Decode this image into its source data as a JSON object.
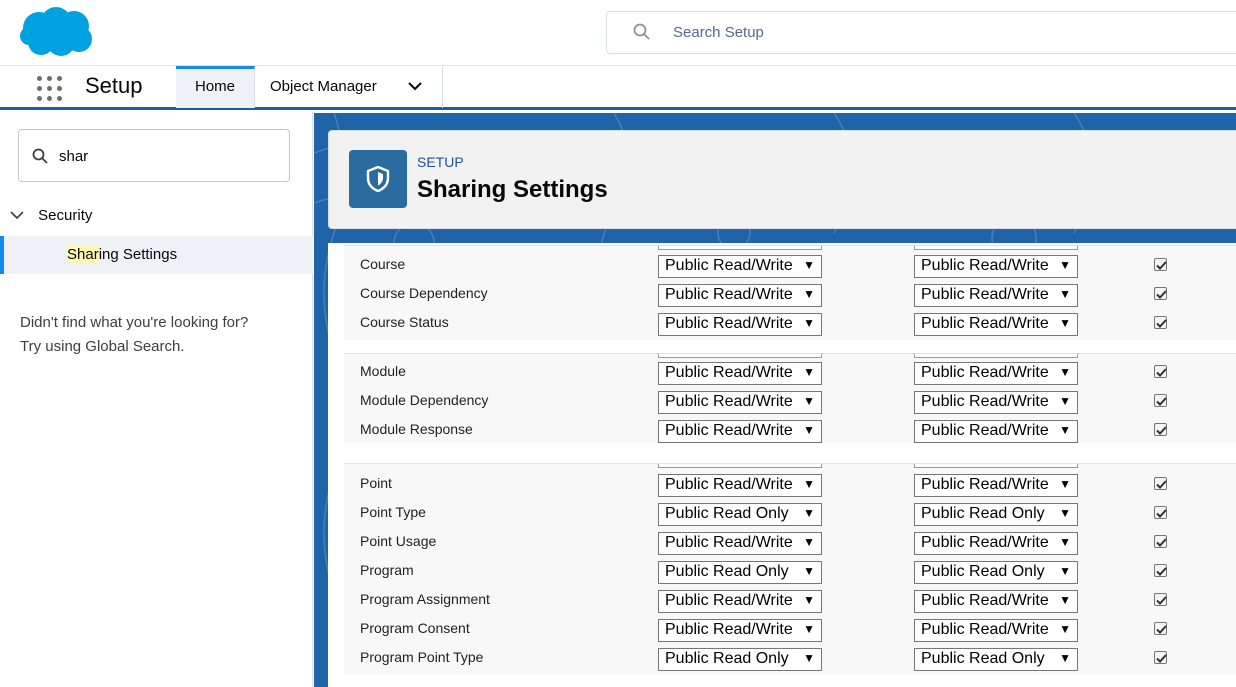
{
  "header": {
    "search_placeholder": "Search Setup"
  },
  "nav": {
    "app_name": "Setup",
    "tabs": [
      {
        "label": "Home"
      },
      {
        "label": "Object Manager"
      }
    ]
  },
  "sidebar": {
    "search_value": "shar",
    "section": "Security",
    "item_highlight": "Shar",
    "item_rest": "ing Settings",
    "help_line1": "Didn't find what you're looking for?",
    "help_line2": "Try using Global Search."
  },
  "page": {
    "breadcrumb": "SETUP",
    "title": "Sharing Settings"
  },
  "groups": [
    {
      "rows": [
        {
          "name": "Course",
          "access_a": "Public Read/Write",
          "access_b": "Public Read/Write",
          "checked": true
        },
        {
          "name": "Course Dependency",
          "access_a": "Public Read/Write",
          "access_b": "Public Read/Write",
          "checked": true
        },
        {
          "name": "Course Status",
          "access_a": "Public Read/Write",
          "access_b": "Public Read/Write",
          "checked": true
        }
      ]
    },
    {
      "rows": [
        {
          "name": "Module",
          "access_a": "Public Read/Write",
          "access_b": "Public Read/Write",
          "checked": true
        },
        {
          "name": "Module Dependency",
          "access_a": "Public Read/Write",
          "access_b": "Public Read/Write",
          "checked": true
        },
        {
          "name": "Module Response",
          "access_a": "Public Read/Write",
          "access_b": "Public Read/Write",
          "checked": true
        }
      ]
    },
    {
      "rows": [
        {
          "name": "Point",
          "access_a": "Public Read/Write",
          "access_b": "Public Read/Write",
          "checked": true
        },
        {
          "name": "Point Type",
          "access_a": "Public Read Only",
          "access_b": "Public Read Only",
          "checked": true
        },
        {
          "name": "Point Usage",
          "access_a": "Public Read/Write",
          "access_b": "Public Read/Write",
          "checked": true
        },
        {
          "name": "Program",
          "access_a": "Public Read Only",
          "access_b": "Public Read Only",
          "checked": true
        },
        {
          "name": "Program Assignment",
          "access_a": "Public Read/Write",
          "access_b": "Public Read/Write",
          "checked": true
        },
        {
          "name": "Program Consent",
          "access_a": "Public Read/Write",
          "access_b": "Public Read/Write",
          "checked": true
        },
        {
          "name": "Program Point Type",
          "access_a": "Public Read Only",
          "access_b": "Public Read Only",
          "checked": true
        }
      ]
    }
  ],
  "colors": {
    "brand": "#00a1e0",
    "nav_accent": "#1b5f9e",
    "selected_tab_top": "#1589ee",
    "header_icon_bg": "#2a6ba0"
  }
}
